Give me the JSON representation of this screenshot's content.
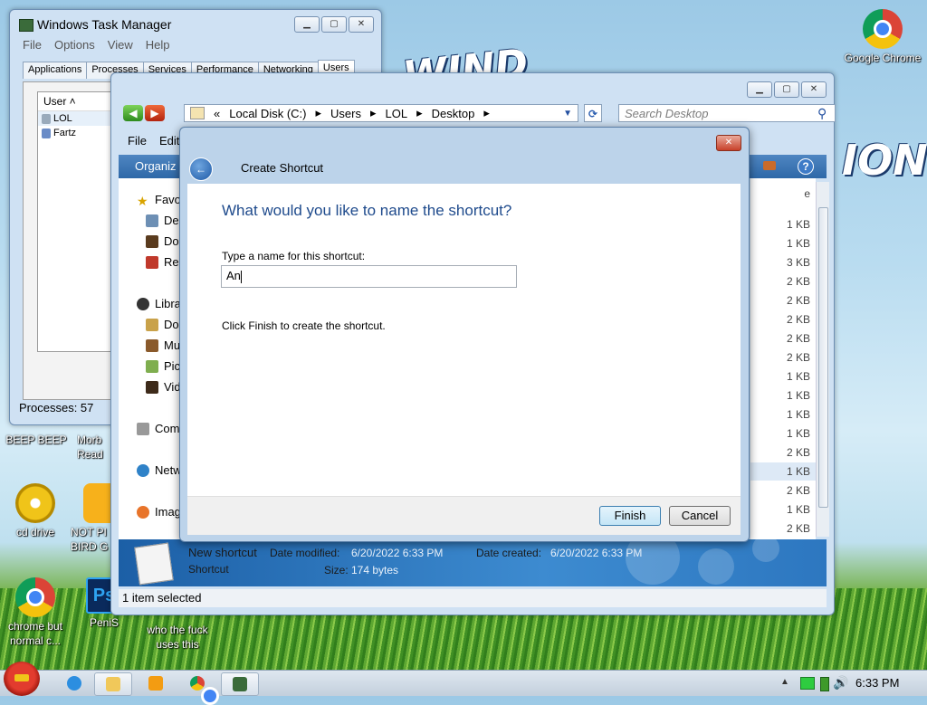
{
  "desktop": {
    "icons": [
      {
        "id": "google-chrome",
        "label": "Google Chrome"
      },
      {
        "id": "beep",
        "label": "BEEP BEEP"
      },
      {
        "id": "morb",
        "label": "Morb Read"
      },
      {
        "id": "cd-drive",
        "label": "cd drive"
      },
      {
        "id": "not-bird",
        "label": "NOT PI BIRD G"
      },
      {
        "id": "chrome-normal",
        "label": "chrome but normal c..."
      },
      {
        "id": "penis",
        "label": "PeniS"
      },
      {
        "id": "who",
        "label": "who the fuck uses this"
      }
    ]
  },
  "task_manager": {
    "title": "Windows Task Manager",
    "menu": [
      "File",
      "Options",
      "View",
      "Help"
    ],
    "tabs": [
      "Applications",
      "Processes",
      "Services",
      "Performance",
      "Networking",
      "Users"
    ],
    "active_tab": "Users",
    "column_user": "User",
    "users": [
      "LOL",
      "Fartz"
    ],
    "processes_label": "Processes: 57"
  },
  "explorer": {
    "breadcrumb": [
      "Local Disk (C:)",
      "Users",
      "LOL",
      "Desktop"
    ],
    "breadcrumb_prefix": "«",
    "search_placeholder": "Search Desktop",
    "menu": [
      "File",
      "Edit"
    ],
    "organize_label": "Organiz",
    "nav": {
      "favorites": "Favo",
      "fav_items": [
        "De",
        "Do",
        "Rec"
      ],
      "libraries": "Libra",
      "lib_items": [
        "Do",
        "Mu",
        "Pic",
        "Vid"
      ],
      "computer": "Com",
      "network": "Netw",
      "image": "Imag"
    },
    "size_header_frag": "e",
    "sizes": [
      "1 KB",
      "1 KB",
      "3 KB",
      "2 KB",
      "2 KB",
      "2 KB",
      "2 KB",
      "2 KB",
      "1 KB",
      "1 KB",
      "1 KB",
      "1 KB",
      "2 KB",
      "1 KB",
      "2 KB",
      "1 KB",
      "2 KB"
    ],
    "details": {
      "name": "New shortcut",
      "type": "Shortcut",
      "modified_label": "Date modified:",
      "modified_value": "6/20/2022 6:33 PM",
      "created_label": "Date created:",
      "created_value": "6/20/2022 6:33 PM",
      "size_label": "Size:",
      "size_value": "174 bytes"
    },
    "status": "1 item selected"
  },
  "dialog": {
    "title": "Create Shortcut",
    "heading": "What would you like to name the shortcut?",
    "field_label": "Type a name for this shortcut:",
    "field_value": "An",
    "hint": "Click Finish to create the shortcut.",
    "finish_label": "Finish",
    "cancel_label": "Cancel"
  },
  "taskbar": {
    "clock": "6:33 PM"
  },
  "colors": {
    "heading_blue": "#1e4a8c",
    "close_red": "#c8412a",
    "cmdbar_blue": "#2e68a8"
  }
}
